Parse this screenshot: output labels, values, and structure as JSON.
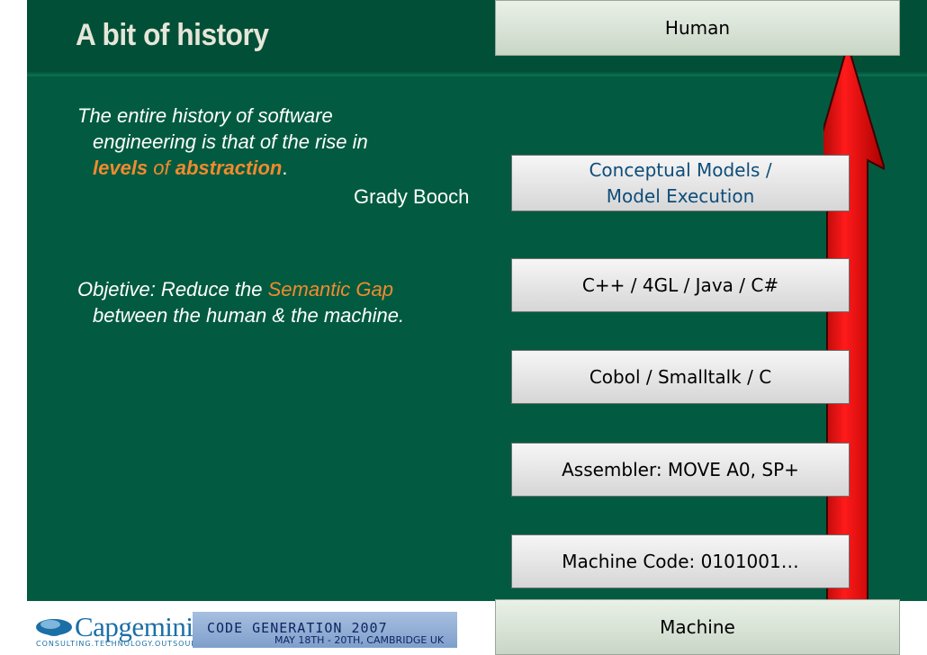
{
  "slide": {
    "title": "A bit of history",
    "quote": {
      "line1": "The entire history of software",
      "line2": "engineering is that of the rise in",
      "levels": "levels",
      "of": " of ",
      "abstraction": "abstraction",
      "period": ".",
      "author": "Grady Booch"
    },
    "objective": {
      "prefix": "Objetive: Reduce the ",
      "highlight": "Semantic Gap",
      "line2": "between the human & the machine."
    }
  },
  "ladder": {
    "top": "Human",
    "levels": [
      {
        "line1": "Conceptual Models /",
        "line2": "Model Execution"
      },
      {
        "label": "C++ / 4GL / Java / C#"
      },
      {
        "label": "Cobol / Smalltalk / C"
      },
      {
        "label": "Assembler: MOVE A0, SP+"
      },
      {
        "label": "Machine Code: 0101001…"
      }
    ],
    "bottom": "Machine"
  },
  "footer": {
    "logo": {
      "word": "Capgemini",
      "tagline": "CONSULTING.TECHNOLOGY.OUTSOURCING"
    },
    "banner": {
      "title": "CODE GENERATION 2007",
      "date": "MAY 18TH - 20TH, CAMBRIDGE UK"
    }
  },
  "colors": {
    "background": "#025b40",
    "accent": "#f28a2e",
    "arrow": "#d40000",
    "concept_text": "#0d4d7a"
  },
  "icons": {
    "arrow": "up-arrow-icon",
    "logo": "capgemini-spades-logo"
  }
}
